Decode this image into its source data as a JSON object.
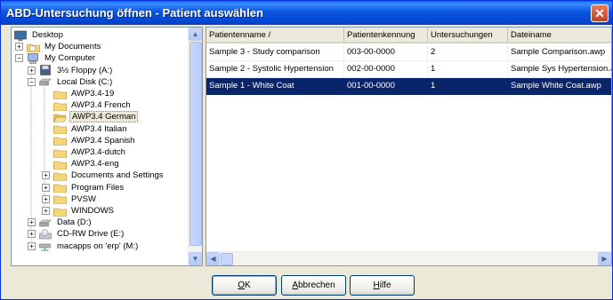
{
  "window": {
    "title": "ABD-Untersuchung öffnen - Patient auswählen",
    "close_glyph": "✕"
  },
  "tree": {
    "items": [
      {
        "label": "Desktop",
        "icon": "desktop-icon",
        "level": 0,
        "expander": ""
      },
      {
        "label": "My Documents",
        "icon": "folder-documents-icon",
        "level": 1,
        "expander": "+"
      },
      {
        "label": "My Computer",
        "icon": "computer-icon",
        "level": 1,
        "expander": "−"
      },
      {
        "label": "3½ Floppy (A:)",
        "icon": "floppy-icon",
        "level": 2,
        "expander": "+"
      },
      {
        "label": "Local Disk (C:)",
        "icon": "disk-icon",
        "level": 2,
        "expander": "−"
      },
      {
        "label": "AWP3.4-19",
        "icon": "folder-icon",
        "level": 3,
        "expander": ""
      },
      {
        "label": "AWP3.4 French",
        "icon": "folder-icon",
        "level": 3,
        "expander": ""
      },
      {
        "label": "AWP3.4 German",
        "icon": "folder-open-icon",
        "level": 3,
        "expander": "",
        "selected": true
      },
      {
        "label": "AWP3.4 Italian",
        "icon": "folder-icon",
        "level": 3,
        "expander": ""
      },
      {
        "label": "AWP3.4 Spanish",
        "icon": "folder-icon",
        "level": 3,
        "expander": ""
      },
      {
        "label": "AWP3.4-dutch",
        "icon": "folder-icon",
        "level": 3,
        "expander": ""
      },
      {
        "label": "AWP3.4-eng",
        "icon": "folder-icon",
        "level": 3,
        "expander": ""
      },
      {
        "label": "Documents and Settings",
        "icon": "folder-icon",
        "level": 3,
        "expander": "+"
      },
      {
        "label": "Program Files",
        "icon": "folder-icon",
        "level": 3,
        "expander": "+"
      },
      {
        "label": "PVSW",
        "icon": "folder-icon",
        "level": 3,
        "expander": "+"
      },
      {
        "label": "WINDOWS",
        "icon": "folder-icon",
        "level": 3,
        "expander": "+"
      },
      {
        "label": "Data (D:)",
        "icon": "disk-icon",
        "level": 2,
        "expander": "+"
      },
      {
        "label": "CD-RW Drive (E:)",
        "icon": "cd-drive-icon",
        "level": 2,
        "expander": "+"
      },
      {
        "label": "macapps on 'erp' (M:)",
        "icon": "network-drive-icon",
        "level": 2,
        "expander": "+"
      }
    ]
  },
  "list": {
    "columns": [
      "Patientenname /",
      "Patientenkennung",
      "Untersuchungen",
      "Dateiname"
    ],
    "rows": [
      [
        "Sample 3 - Study comparison",
        "003-00-0000",
        "2",
        "Sample Comparison.awp"
      ],
      [
        "Sample 2 - Systolic Hypertension",
        "002-00-0000",
        "1",
        "Sample Sys Hypertension.awp"
      ],
      [
        "Sample 1 - White Coat",
        "001-00-0000",
        "1",
        "Sample White Coat.awp"
      ]
    ],
    "selected_row": 2
  },
  "buttons": {
    "ok": {
      "accel": "O",
      "rest": "K"
    },
    "cancel": {
      "accel": "A",
      "rest": "bbrechen"
    },
    "help": {
      "accel": "H",
      "rest": "ilfe"
    }
  },
  "colors": {
    "selection": "#0A246A",
    "titlebar": "#0448D6",
    "close": "#C5401F",
    "face": "#ECE9D8"
  }
}
